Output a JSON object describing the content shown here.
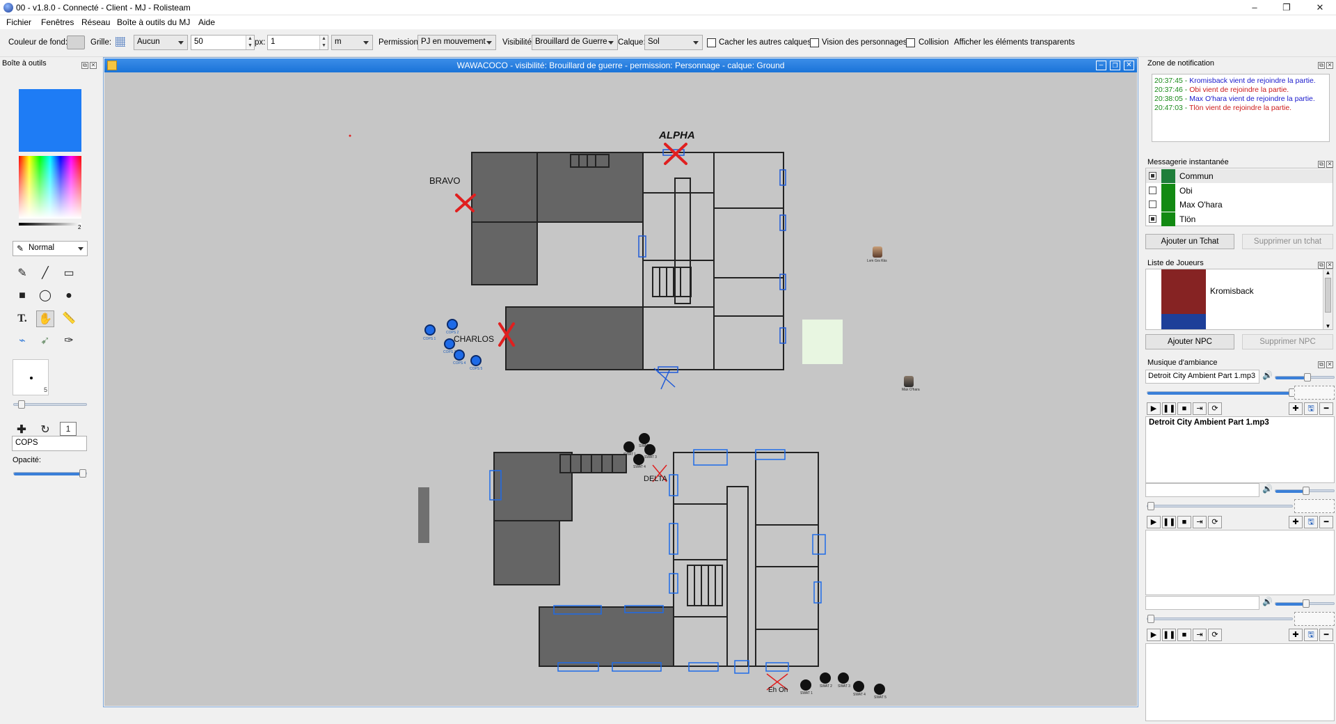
{
  "window": {
    "title": "00 - v1.8.0 - Connecté - Client - MJ - Rolisteam",
    "controls": {
      "minimize": "–",
      "maximize": "❐",
      "close": "✕"
    }
  },
  "menu": [
    "Fichier",
    "Fenêtres",
    "Réseau",
    "Boîte à outils du MJ",
    "Aide"
  ],
  "toolbar": {
    "bg_color_label": "Couleur de fond:",
    "grid_label": "Grille:",
    "grid_value": "Aucun",
    "grid_size": "50",
    "px_label": "px:",
    "px_value": "1",
    "unit_value": "m",
    "permission_label": "Permission:",
    "permission_value": "PJ en mouvement",
    "visibility_label": "Visibilité:",
    "visibility_value": "Brouillard de Guerre",
    "layer_label": "Calque:",
    "layer_value": "Sol",
    "hide_layers": "Cacher les autres calques",
    "char_vision": "Vision des personnages",
    "collision": "Collision",
    "show_transparent": "Afficher les éléments transparents"
  },
  "toolbox": {
    "title": "Boîte à outils",
    "color": "#1e7cf5",
    "mode": "Normal",
    "pen_size": "5",
    "npc_name": "COPS",
    "opacity_label": "Opacité:",
    "grayscale_max": "2"
  },
  "map_window": {
    "title": "WAWACOCO - visibilité: Brouillard de guerre - permission: Personnage - calque: Ground",
    "labels": {
      "alpha": "ALPHA",
      "bravo": "BRAVO",
      "charlos": "CHARLOS",
      "delta": "DELTA",
      "ehoh": "Eh Oh"
    },
    "tokens": {
      "cops": [
        "COPS 1",
        "COPS 2",
        "COPS 3",
        "COPS 4",
        "COPS 5",
        "COPS 6"
      ],
      "swat_a": [
        "SWAT 1",
        "SWAT 2",
        "SWAT 3",
        "SWAT 4"
      ],
      "swat_b": [
        "SWAT 1",
        "SWAT 2",
        "SWAT 3",
        "SWAT 4",
        "SWAT 5"
      ],
      "player1": "Lvm Grs Kks",
      "player2": "Max O'hara"
    }
  },
  "notifications": {
    "title": "Zone de notification",
    "lines": [
      {
        "text": "20:37:45 - Kromisback vient de rejoindre la partie.",
        "color": "#1a1acc",
        "time_color": "#1a8a1a"
      },
      {
        "text": "20:37:46 - Obi vient de rejoindre la partie.",
        "color": "#cc1a1a",
        "time_color": "#1a8a1a"
      },
      {
        "text": "20:38:05 - Max O'hara vient de rejoindre la partie.",
        "color": "#1a1acc",
        "time_color": "#1a8a1a"
      },
      {
        "text": "20:47:03 - Tlön vient de rejoindre la partie.",
        "color": "#cc1a1a",
        "time_color": "#1a8a1a"
      }
    ]
  },
  "chat": {
    "title": "Messagerie instantanée",
    "rows": [
      {
        "name": "Commun",
        "checked": true,
        "color": "#1e7e3a"
      },
      {
        "name": "Obi",
        "checked": false,
        "color": "#138a13"
      },
      {
        "name": "Max O'hara",
        "checked": false,
        "color": "#138a13"
      },
      {
        "name": "Tlön",
        "checked": true,
        "color": "#138a13"
      }
    ],
    "add": "Ajouter un Tchat",
    "remove": "Supprimer un tchat"
  },
  "players": {
    "title": "Liste de Joueurs",
    "rows": [
      {
        "name": "Kromisback",
        "color": "#862323"
      }
    ],
    "add": "Ajouter NPC",
    "remove": "Supprimer NPC"
  },
  "music": {
    "title": "Musique d'ambiance",
    "tracks": [
      {
        "file": "Detroit City Ambient Part 1.mp3",
        "playlist": "Detroit City Ambient Part 1.mp3"
      },
      {
        "file": "",
        "playlist": ""
      },
      {
        "file": "",
        "playlist": ""
      }
    ]
  }
}
